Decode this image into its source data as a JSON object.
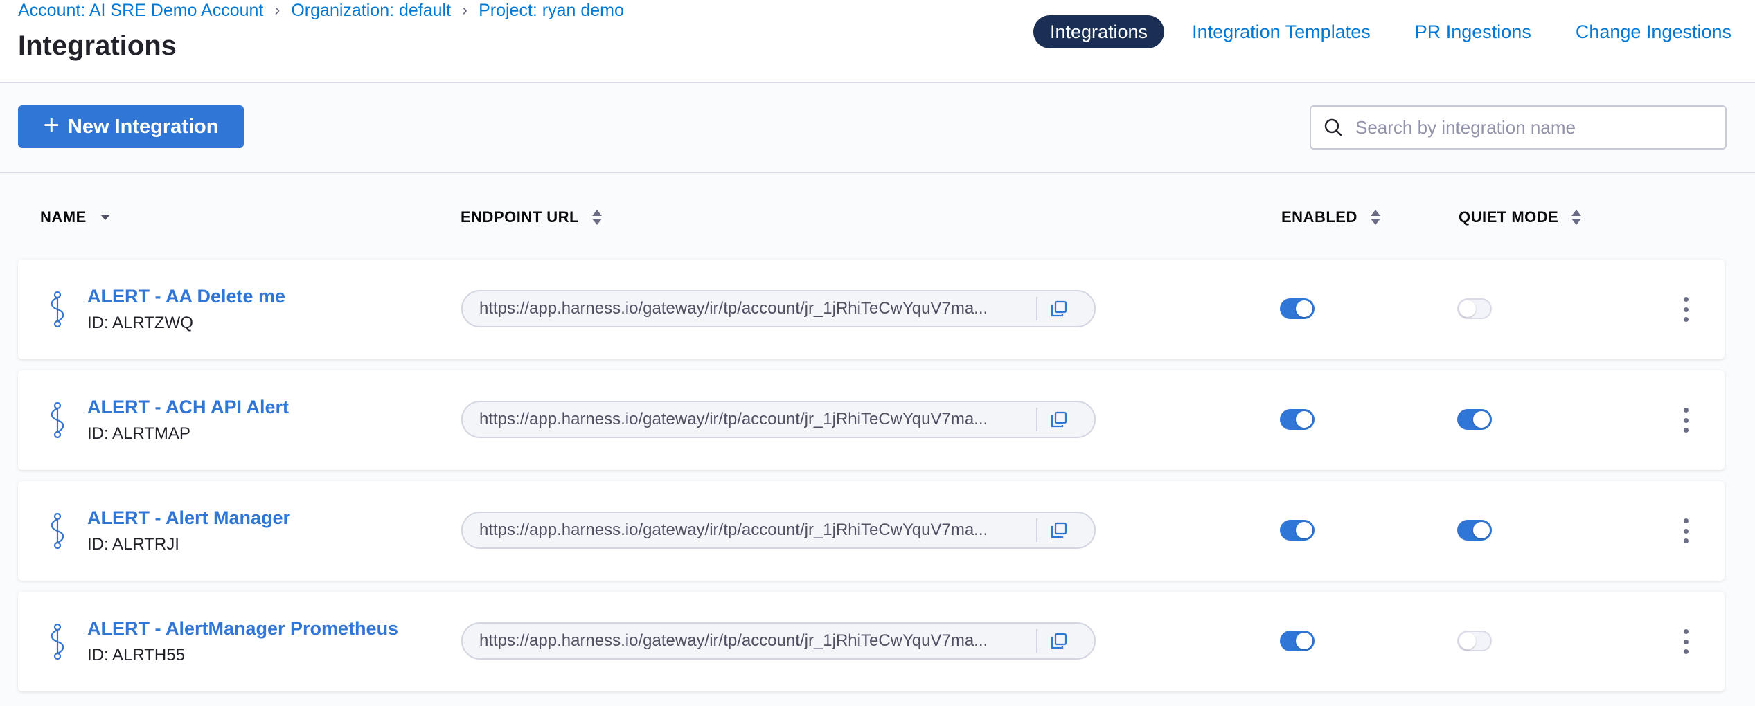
{
  "breadcrumb": {
    "account": "Account: AI SRE Demo Account",
    "organization": "Organization: default",
    "project": "Project: ryan demo"
  },
  "page": {
    "title": "Integrations"
  },
  "nav_tabs": [
    {
      "label": "Integrations",
      "active": true
    },
    {
      "label": "Integration Templates",
      "active": false
    },
    {
      "label": "PR Ingestions",
      "active": false
    },
    {
      "label": "Change Ingestions",
      "active": false
    }
  ],
  "toolbar": {
    "new_button_label": "New Integration",
    "search_placeholder": "Search by integration name",
    "search_value": ""
  },
  "table": {
    "columns": {
      "name": "NAME",
      "endpoint_url": "ENDPOINT URL",
      "enabled": "ENABLED",
      "quiet_mode": "QUIET MODE"
    },
    "rows": [
      {
        "name": "ALERT - AA Delete me",
        "id": "ID: ALRTZWQ",
        "url": "https://app.harness.io/gateway/ir/tp/account/jr_1jRhiTeCwYquV7ma...",
        "enabled": true,
        "quiet_mode": false
      },
      {
        "name": "ALERT - ACH API Alert",
        "id": "ID: ALRTMAP",
        "url": "https://app.harness.io/gateway/ir/tp/account/jr_1jRhiTeCwYquV7ma...",
        "enabled": true,
        "quiet_mode": true
      },
      {
        "name": "ALERT - Alert Manager",
        "id": "ID: ALRTRJI",
        "url": "https://app.harness.io/gateway/ir/tp/account/jr_1jRhiTeCwYquV7ma...",
        "enabled": true,
        "quiet_mode": true
      },
      {
        "name": "ALERT - AlertManager Prometheus",
        "id": "ID: ALRTH55",
        "url": "https://app.harness.io/gateway/ir/tp/account/jr_1jRhiTeCwYquV7ma...",
        "enabled": true,
        "quiet_mode": false
      }
    ]
  },
  "icons": {
    "breadcrumb_separator": "chevron-right-icon",
    "new_button": "plus-icon",
    "search": "search-icon",
    "row_type": "integration-icon",
    "copy": "copy-icon",
    "row_menu": "more-vertical-icon",
    "sort_desc": "caret-down-icon",
    "sort_both": "sort-icon"
  },
  "colors": {
    "accent": "#3076d6",
    "link": "#0278d5",
    "active_tab_bg": "#1b2f55",
    "toggle_off_bg": "#f3f3fa"
  }
}
